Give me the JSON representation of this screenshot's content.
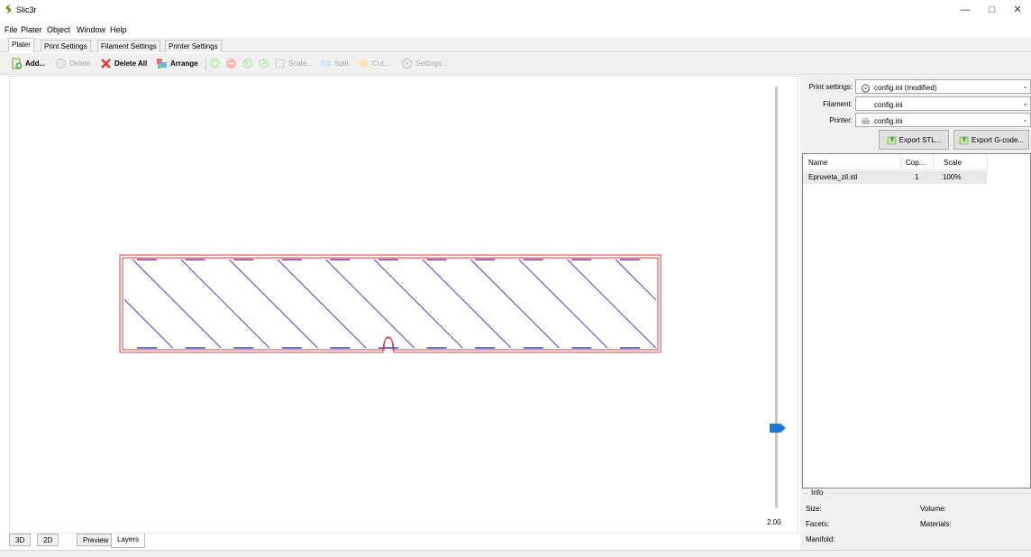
{
  "window": {
    "title": "Slic3r",
    "minimize_glyph": "—",
    "maximize_glyph": "□",
    "close_glyph": "✕"
  },
  "menu": [
    "File",
    "Plater",
    "Object",
    "Window",
    "Help"
  ],
  "tabs": [
    {
      "label": "Plater",
      "active": true
    },
    {
      "label": "Print Settings",
      "active": false
    },
    {
      "label": "Filament Settings",
      "active": false
    },
    {
      "label": "Printer Settings",
      "active": false
    }
  ],
  "toolbar": {
    "add": {
      "label": "Add...",
      "icon": "add-file-icon",
      "enabled": true
    },
    "delete": {
      "label": "Delete",
      "icon": "delete-icon",
      "enabled": false
    },
    "delete_all": {
      "label": "Delete All",
      "icon": "red-x-icon",
      "enabled": true
    },
    "arrange": {
      "label": "Arrange",
      "icon": "arrange-icon",
      "enabled": true
    },
    "increase_icon": "plus-icon",
    "decrease_icon": "minus-icon",
    "rotate_left_icon": "rotate-left-icon",
    "rotate_right_icon": "rotate-right-icon",
    "scale": {
      "label": "Scale...",
      "icon": "scale-icon",
      "enabled": false
    },
    "split": {
      "label": "Split",
      "icon": "split-icon",
      "enabled": false
    },
    "cut": {
      "label": "Cut...",
      "icon": "cut-icon",
      "enabled": false
    },
    "settings": {
      "label": "Settings...",
      "icon": "settings-icon",
      "enabled": false
    }
  },
  "canvas": {
    "layer_value": "2.00",
    "colors": {
      "perimeter": "#d93b3b",
      "infill": "#4b3fd6",
      "slider_handle": "#1976d2"
    }
  },
  "bottom_tabs": [
    {
      "label": "3D",
      "active": false
    },
    {
      "label": "2D",
      "active": false
    },
    {
      "label": "Preview",
      "active": false
    },
    {
      "label": "Layers",
      "active": true
    }
  ],
  "right_panel": {
    "print_settings_label": "Print settings:",
    "print_settings_value": "config.ini (modified)",
    "filament_label": "Filament:",
    "filament_value": "config.ini",
    "printer_label": "Printer:",
    "printer_value": "config.ini",
    "export_stl": "Export STL...",
    "export_gcode": "Export G-code...",
    "object_list": {
      "columns": [
        "Name",
        "Cop...",
        "Scale"
      ],
      "rows": [
        {
          "name": "Epruveta_zil.stl",
          "copies": "1",
          "scale": "100%"
        }
      ]
    },
    "info": {
      "title": "Info",
      "size_label": "Size:",
      "volume_label": "Volume:",
      "facets_label": "Facets:",
      "materials_label": "Materials:",
      "manifold_label": "Manifold:"
    }
  }
}
